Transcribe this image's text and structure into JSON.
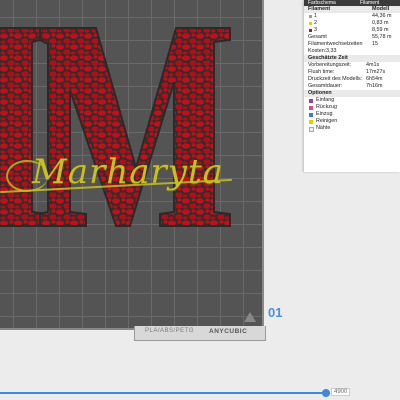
{
  "panel": {
    "top_tab_1": "Farbschema",
    "top_tab_2": "Filament",
    "filament_header": "Filament",
    "model_header": "Modell",
    "filaments": [
      {
        "num": "1",
        "color": "#9e9e9e",
        "value": "44,36 m"
      },
      {
        "num": "2",
        "color": "#d6d600",
        "value": "0,83 m"
      },
      {
        "num": "3",
        "color": "#c0101a",
        "value": "8,59 m"
      }
    ],
    "gesamt_label": "Gesamt",
    "gesamt_value": "55,78 m",
    "wechsel_label": "Filamentwechselzeiten",
    "wechsel_value": "15",
    "kosten_label": "Kosten:",
    "kosten_value": "3,33",
    "zeit_header": "Geschätzte Zeit",
    "zeit": [
      {
        "label": "Vorbereitungszeit:",
        "value": "4m1s"
      },
      {
        "label": "Flush time:",
        "value": "17m27s"
      },
      {
        "label": "Druckzeit des Modells:",
        "value": "6h54m"
      },
      {
        "label": "Gesamtdauer:",
        "value": "7h16m"
      }
    ],
    "optionen_header": "Optionen",
    "optionen": [
      {
        "label": "Einfang",
        "color": "#8e44ad"
      },
      {
        "label": "Rückzug",
        "color": "#d94a8c"
      },
      {
        "label": "Einzug",
        "color": "#3a7bd5"
      },
      {
        "label": "Reinigen",
        "color": "#e0d000"
      },
      {
        "label": "Nähte",
        "color": "#f0f0f0"
      }
    ]
  },
  "model_text": "Marharyta",
  "bed": {
    "materials": "PLA/ABS/PETG",
    "brand": "ANYCUBIC",
    "plate_number": "01"
  },
  "layer_slider": {
    "value_label": "4900"
  },
  "colors": {
    "red": "#c0101a",
    "yellow": "#c8c020",
    "accent": "#3f87e0"
  }
}
